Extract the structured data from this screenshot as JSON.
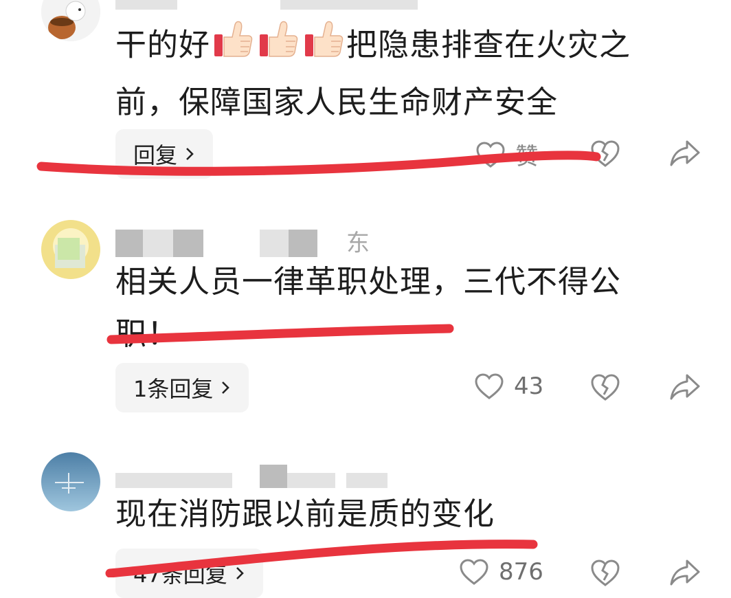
{
  "comments": [
    {
      "text_line1": "干的好",
      "text_line1_after": "把隐患排查在火灾之",
      "text_line2": "前，保障国家人民生命财产安全",
      "reply_label": "回复",
      "like_label": "赞",
      "emoji": "thumbs-up-icon"
    },
    {
      "meta_region": "东",
      "text_line1": "相关人员一律革职处理，三代不得公",
      "text_line2": "职！",
      "reply_label": "1条回复",
      "like_count": "43"
    },
    {
      "text_line1": "现在消防跟以前是质的变化",
      "reply_label": "47条回复",
      "like_count": "876"
    }
  ],
  "colors": {
    "annotation": "#e8343e",
    "icon": "#8a8a8a"
  }
}
